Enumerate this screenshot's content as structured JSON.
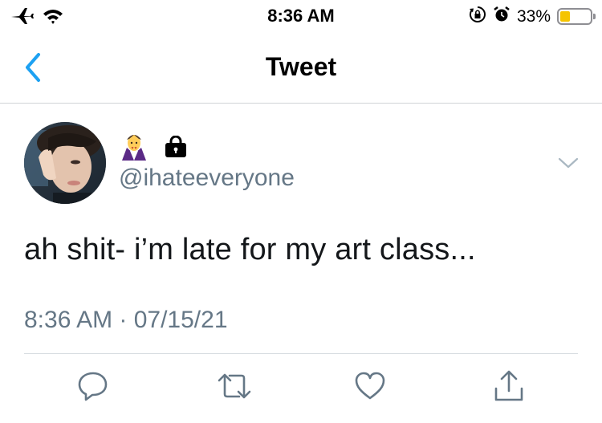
{
  "status_bar": {
    "time": "8:36 AM",
    "battery_percent": "33%",
    "battery_level": 0.33,
    "left_icons": [
      "airplane-icon",
      "wifi-icon"
    ],
    "right_icons": [
      "rotation-lock-icon",
      "alarm-icon",
      "battery-icon"
    ],
    "battery_color": "#f5c400"
  },
  "nav": {
    "title": "Tweet",
    "back_icon": "chevron-left-icon",
    "accent_color": "#1da1f2"
  },
  "tweet": {
    "display_name_icons": [
      "vampire-emoji",
      "lock-icon"
    ],
    "handle": "@ihateeveryone",
    "text": "ah shit- i’m late for my art class...",
    "timestamp": "8:36 AM · 07/15/21",
    "avatar": "avatar-photo"
  },
  "actions": [
    {
      "icon": "reply-icon"
    },
    {
      "icon": "retweet-icon"
    },
    {
      "icon": "like-icon"
    },
    {
      "icon": "share-icon"
    }
  ]
}
